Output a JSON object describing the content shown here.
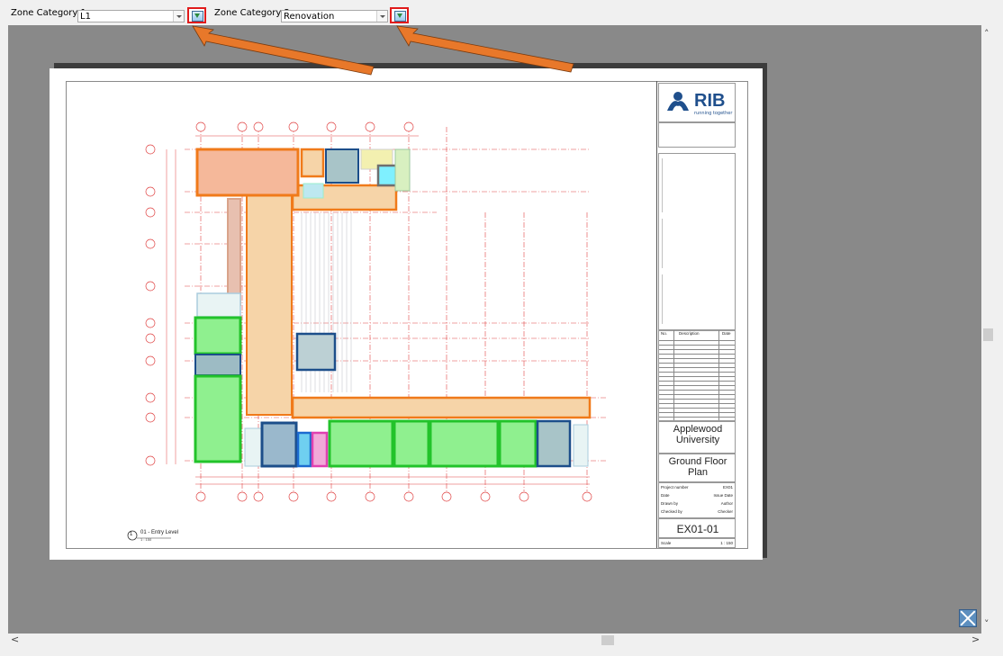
{
  "toolbar": {
    "zone1_label": "Zone Category 1:",
    "zone1_value": "L1",
    "zone2_label": "Zone Category 2:",
    "zone2_value": "Renovation"
  },
  "titleblock": {
    "logo_text": "RIB",
    "logo_tagline": "running together",
    "revision_headers": {
      "no": "No.",
      "description": "Description",
      "date": "Date"
    },
    "client": "Applewood University",
    "sheet_name": "Ground Floor Plan",
    "project_number_label": "Project number",
    "project_number": "EX01",
    "date_label": "Date",
    "date_value": "Issue Date",
    "drawn_by_label": "Drawn by",
    "drawn_by": "Author",
    "checked_by_label": "Checked by",
    "checked_by": "Checker",
    "sheet_number": "EX01-01",
    "scale_label": "Scale",
    "scale": "1 : 150"
  },
  "view_title": {
    "number": "1",
    "name": "01 - Entry Level",
    "scale": "1 : 150"
  },
  "colors": {
    "highlight_red": "#e01b1b",
    "arrow_orange": "#e8782a",
    "zone_orange": "#f07a1a",
    "zone_green": "#22c32a",
    "zone_blue": "#1c4e8a",
    "viewport_gray": "#898989"
  }
}
